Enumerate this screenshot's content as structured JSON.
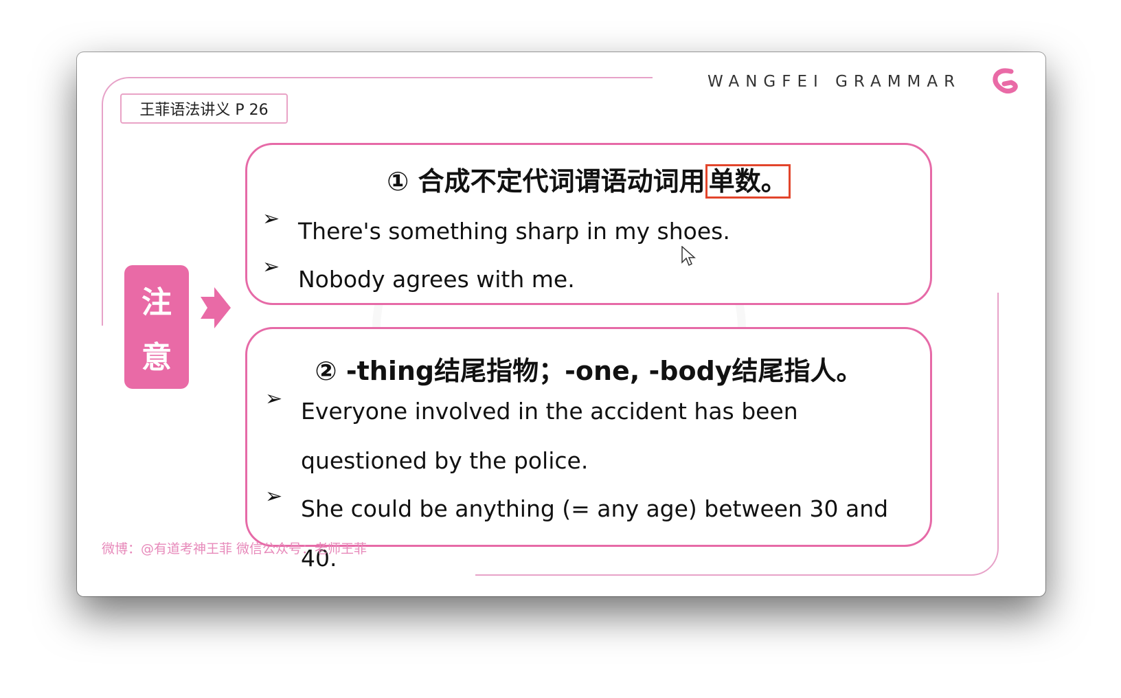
{
  "page_tag": "王菲语法讲义  P 26",
  "brand": "WANGFEI GRAMMAR",
  "badge": {
    "line1": "注",
    "line2": "意"
  },
  "card1": {
    "title_prefix": "① 合成不定代词谓语动词用",
    "title_highlight": "单数。",
    "bullets": [
      "There's something sharp in my shoes.",
      "Nobody agrees with me."
    ]
  },
  "card2": {
    "title": "② -thing结尾指物；-one, -body结尾指人。",
    "bullets": [
      "Everyone involved in the accident has been questioned by the police.",
      "She could be anything (= any age) between 30 and 40."
    ]
  },
  "footer": "微博：@有道考神王菲  微信公众号：老师王菲",
  "colors": {
    "accent_pink": "#e96aa6",
    "highlight_red": "#e2452b",
    "line_pink": "#e7a2c8"
  },
  "icons": {
    "logo": "g-logo-icon",
    "bullet": "arrow-bullet-icon",
    "pointer": "mouse-cursor-icon"
  }
}
